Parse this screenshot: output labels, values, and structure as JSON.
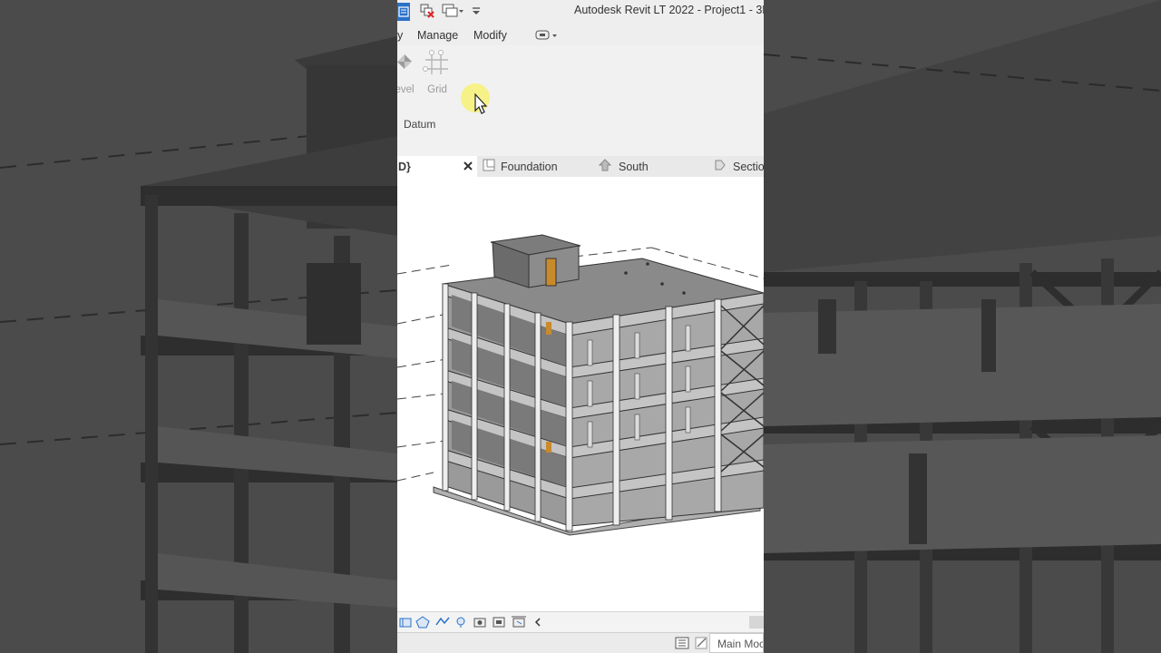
{
  "app": {
    "title": "Autodesk Revit LT 2022 - Project1 - 3D V"
  },
  "menu": {
    "items": [
      "y",
      "Manage",
      "Modify"
    ]
  },
  "ribbon": {
    "level_label": "evel",
    "grid_label": "Grid",
    "panel_label": "Datum"
  },
  "tabs": [
    {
      "label": "D}"
    },
    {
      "label": "Foundation"
    },
    {
      "label": "South"
    },
    {
      "label": "Sectio"
    }
  ],
  "status": {
    "model_label": "Main Moc"
  },
  "colors": {
    "accent": "#2a71c8",
    "door": "#c98a2b",
    "cursor_highlight": "#f7f274"
  }
}
